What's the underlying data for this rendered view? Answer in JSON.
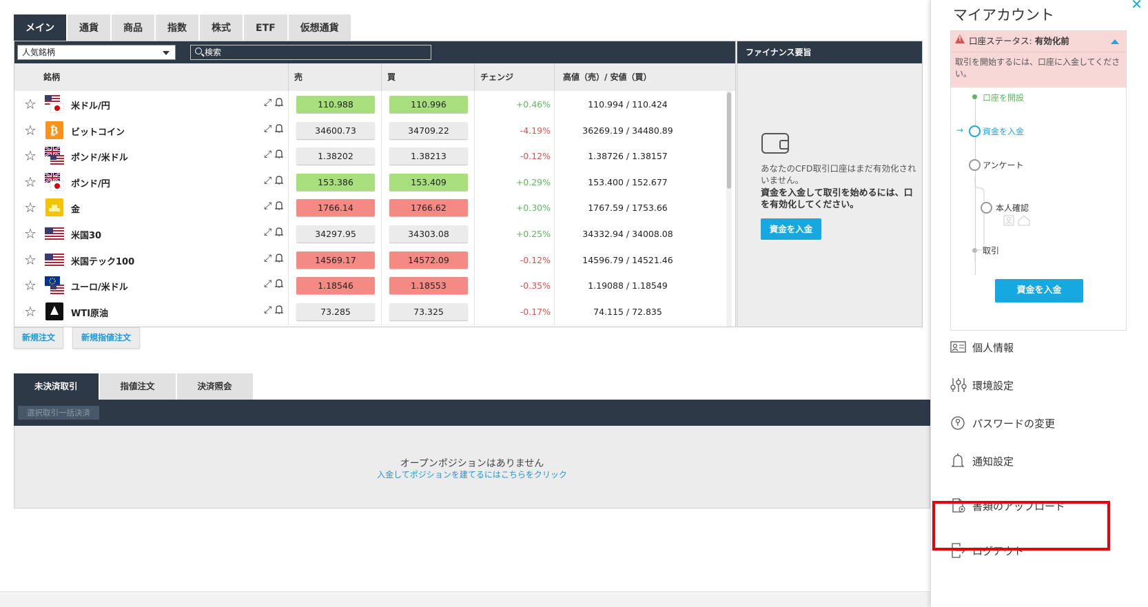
{
  "top_tabs": [
    "メイン",
    "通貨",
    "商品",
    "指数",
    "株式",
    "ETF",
    "仮想通貨"
  ],
  "toolbar": {
    "category_select": "人気銘柄",
    "search_placeholder": "検索"
  },
  "table_headers": {
    "instrument": "銘柄",
    "sell": "売",
    "buy": "買",
    "change": "チェンジ",
    "high_low": "高値（売）/ 安値（買）"
  },
  "instruments": [
    {
      "name": "米ドル/円",
      "flag": "us-jp-flag-icon",
      "sell": "110.988",
      "buy": "110.996",
      "sell_color": "green",
      "buy_color": "green",
      "change": "+0.46%",
      "change_dir": "pos",
      "high_low": "110.994 / 110.424"
    },
    {
      "name": "ビットコイン",
      "flag": "bitcoin-icon",
      "sell": "34600.73",
      "buy": "34709.22",
      "sell_color": "grey",
      "buy_color": "grey",
      "change": "-4.19%",
      "change_dir": "neg",
      "high_low": "36269.19 / 34480.89"
    },
    {
      "name": "ポンド/米ドル",
      "flag": "gb-us-flag-icon",
      "sell": "1.38202",
      "buy": "1.38213",
      "sell_color": "grey",
      "buy_color": "grey",
      "change": "-0.12%",
      "change_dir": "neg",
      "high_low": "1.38726 / 1.38157"
    },
    {
      "name": "ポンド/円",
      "flag": "gb-jp-flag-icon",
      "sell": "153.386",
      "buy": "153.409",
      "sell_color": "green",
      "buy_color": "green",
      "change": "+0.29%",
      "change_dir": "pos",
      "high_low": "153.400 / 152.677"
    },
    {
      "name": "金",
      "flag": "gold-icon",
      "sell": "1766.14",
      "buy": "1766.62",
      "sell_color": "red",
      "buy_color": "red",
      "change": "+0.30%",
      "change_dir": "pos",
      "high_low": "1767.59 / 1753.66"
    },
    {
      "name": "米国30",
      "flag": "us-flag-icon",
      "sell": "34297.95",
      "buy": "34303.08",
      "sell_color": "grey",
      "buy_color": "grey",
      "change": "+0.25%",
      "change_dir": "pos",
      "high_low": "34332.94 / 34008.08"
    },
    {
      "name": "米国テック100",
      "flag": "us-flag-icon",
      "sell": "14569.17",
      "buy": "14572.09",
      "sell_color": "red",
      "buy_color": "red",
      "change": "-0.12%",
      "change_dir": "neg",
      "high_low": "14596.79 / 14521.46"
    },
    {
      "name": "ユーロ/米ドル",
      "flag": "eu-us-flag-icon",
      "sell": "1.18546",
      "buy": "1.18553",
      "sell_color": "red",
      "buy_color": "red",
      "change": "-0.35%",
      "change_dir": "neg",
      "high_low": "1.19088 / 1.18549"
    },
    {
      "name": "WTI原油",
      "flag": "oil-icon",
      "sell": "73.285",
      "buy": "73.325",
      "sell_color": "grey",
      "buy_color": "grey",
      "change": "-0.17%",
      "change_dir": "neg",
      "high_low": "74.115 / 72.835"
    }
  ],
  "order_buttons": {
    "new_order": "新規注文",
    "new_limit_order": "新規指値注文"
  },
  "finance": {
    "title": "ファイナンス要旨",
    "msg1": "あなたのCFD取引口座はまだ有効化されていません。",
    "msg1_line1": "あなたのCFD取引口座はまだ有効化され",
    "msg1_line2": "いません。",
    "msg2_line1": "資金を入金して取引を始めるには、口",
    "msg2_line2": "を有効化してください。",
    "deposit_button": "資金を入金"
  },
  "positions": {
    "tabs": [
      "未決済取引",
      "指値注文",
      "決済照会"
    ],
    "bulk_close": "選択取引一括決済",
    "empty_title": "オープンポジションはありません",
    "empty_link": "入金してポジションを建てるにはこちらをクリック"
  },
  "account": {
    "title": "マイアカウント",
    "status_label": "口座ステータス:",
    "status_value": "有効化前",
    "status_desc": "取引を開始するには、口座に入金してください。",
    "steps": [
      "口座を開設",
      "資金を入金",
      "アンケート",
      "本人確認",
      "取引"
    ],
    "deposit_button": "資金を入金",
    "menu": [
      "個人情報",
      "環境設定",
      "パスワードの変更",
      "通知設定",
      "書類のアップロード",
      "ログアウト"
    ]
  },
  "colors": {
    "dark": "#2d3947",
    "accent": "#16a9e1",
    "green_price": "#a8de7b",
    "red_price": "#f58a85",
    "highlight": "#e8000b"
  }
}
